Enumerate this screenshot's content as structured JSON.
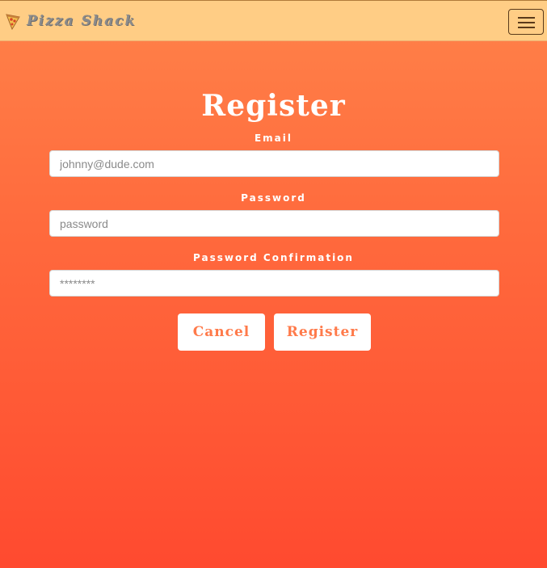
{
  "navbar": {
    "brand_icon": "pizza-slice-icon",
    "brand_name": "Pizza Shack",
    "menu_icon": "hamburger-menu-icon"
  },
  "form": {
    "title": "Register",
    "email": {
      "label": "Email",
      "placeholder": "johnny@dude.com",
      "value": ""
    },
    "password": {
      "label": "Password",
      "placeholder": "password",
      "value": ""
    },
    "password_confirmation": {
      "label": "Password Confirmation",
      "placeholder": "********",
      "value": ""
    },
    "cancel_label": "Cancel",
    "register_label": "Register"
  },
  "colors": {
    "navbar": "#ffcd85",
    "gradient_top": "#ff8249",
    "gradient_bottom": "#ff4a2f",
    "button_text": "#ff7a4a"
  }
}
